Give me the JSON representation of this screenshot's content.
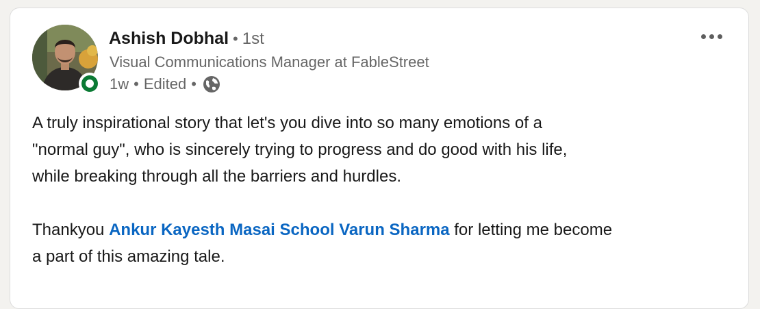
{
  "post": {
    "author": {
      "name": "Ashish Dobhal",
      "separator": "•",
      "degree": "1st",
      "headline": "Visual Communications Manager at FableStreet",
      "presence_status": "online",
      "avatar_icon": "profile-photo"
    },
    "meta": {
      "time": "1w",
      "dot": "•",
      "edited": "Edited",
      "visibility_icon": "globe-icon"
    },
    "body": {
      "line1": "A truly inspirational story that let's you dive into so many emotions of a",
      "line2": "\"normal guy\", who is sincerely trying to progress and do good with his life,",
      "line3": "while breaking through all the barriers and hurdles.",
      "thanks_prefix": "Thankyou ",
      "mentions": [
        "Ankur Kayesth",
        "Masai School",
        "Varun Sharma"
      ],
      "thanks_suffix": " for letting me become",
      "last_line": "a part of this amazing tale."
    }
  },
  "colors": {
    "link": "#0a66c2",
    "text": "#191919",
    "muted": "#666666",
    "online": "#0b7a34"
  }
}
